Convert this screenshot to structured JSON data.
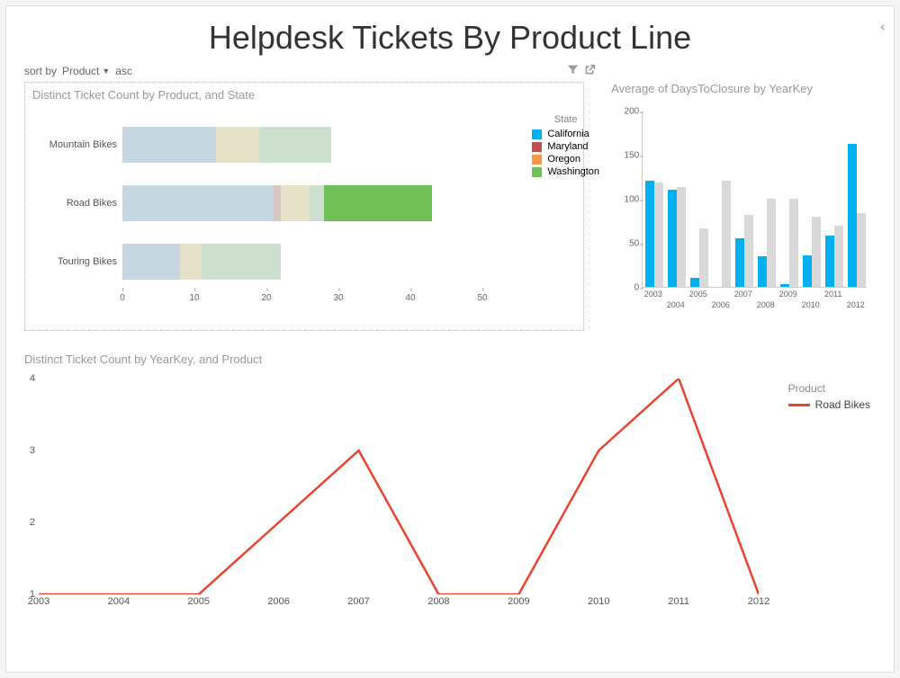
{
  "page": {
    "title": "Helpdesk Tickets By Product Line"
  },
  "sort_row": {
    "sort_by_label": "sort by",
    "field": "Product",
    "direction": "asc"
  },
  "colors": {
    "california": "#00B0F0",
    "maryland": "#C0504D",
    "oregon": "#F79646",
    "washington": "#70C055",
    "ghost_blue": "#C6D7E1",
    "ghost_tan": "#E6E1C9",
    "ghost_red": "#D9C5C4",
    "ghost_green": "#CDE0CF",
    "ghost_grey": "#D9D9D9",
    "line_red": "#E8442C"
  },
  "chart_data": [
    {
      "id": "stacked_bar",
      "type": "bar",
      "orientation": "horizontal",
      "stacked": true,
      "title": "Distinct Ticket Count by Product, and State",
      "legend_title": "State",
      "legend_items": [
        "California",
        "Maryland",
        "Washington",
        "Oregon"
      ],
      "x_ticks": [
        0,
        10,
        20,
        30,
        40,
        50
      ],
      "xlim": [
        0,
        50
      ],
      "categories": [
        "Mountain Bikes",
        "Road Bikes",
        "Touring Bikes"
      ],
      "series": [
        {
          "name": "California (bg)",
          "values": [
            13,
            21,
            8
          ],
          "color_key": "ghost_blue"
        },
        {
          "name": "Maryland (bg)",
          "values": [
            0,
            1,
            0
          ],
          "color_key": "ghost_red"
        },
        {
          "name": "Oregon (bg)",
          "values": [
            6,
            4,
            3
          ],
          "color_key": "ghost_tan"
        },
        {
          "name": "Washington (bg)",
          "values": [
            10,
            2,
            11
          ],
          "color_key": "ghost_green"
        },
        {
          "name": "Washington",
          "values": [
            0,
            15,
            0
          ],
          "color_key": "washington"
        }
      ]
    },
    {
      "id": "clustered_col",
      "type": "bar",
      "orientation": "vertical",
      "grouped": true,
      "title": "Average of DaysToClosure by YearKey",
      "y_ticks": [
        0,
        50,
        100,
        150,
        200
      ],
      "ylim": [
        0,
        200
      ],
      "categories": [
        "2003",
        "2004",
        "2005",
        "2006",
        "2007",
        "2008",
        "2009",
        "2010",
        "2011",
        "2012"
      ],
      "series": [
        {
          "name": "Highlighted",
          "values": [
            120,
            110,
            10,
            0,
            55,
            35,
            3,
            36,
            58,
            162
          ],
          "color_key": "california"
        },
        {
          "name": "Context",
          "values": [
            118,
            113,
            66,
            120,
            82,
            100,
            100,
            80,
            69,
            84
          ],
          "color_key": "ghost_grey"
        }
      ]
    },
    {
      "id": "line",
      "type": "line",
      "title": "Distinct Ticket Count by YearKey, and Product",
      "legend_title": "Product",
      "y_ticks": [
        1,
        2,
        3,
        4
      ],
      "ylim": [
        1,
        4
      ],
      "x": [
        "2003",
        "2004",
        "2005",
        "2006",
        "2007",
        "2008",
        "2009",
        "2010",
        "2011",
        "2012"
      ],
      "series": [
        {
          "name": "Road Bikes",
          "values": [
            1,
            1,
            1,
            2,
            3,
            1,
            1,
            3,
            4,
            1
          ],
          "color_key": "line_red"
        }
      ]
    }
  ]
}
